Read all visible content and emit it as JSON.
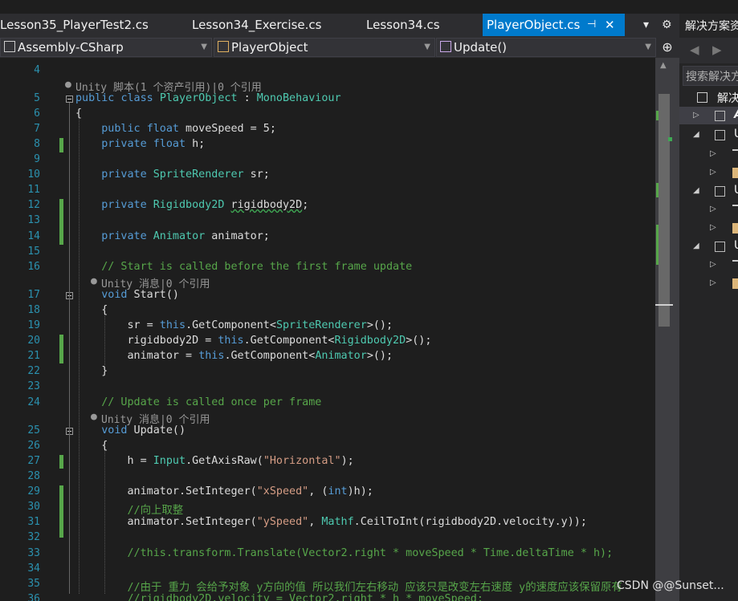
{
  "tabs": [
    {
      "label": "Lesson35_PlayerTest2.cs"
    },
    {
      "label": "Lesson34_Exercise.cs"
    },
    {
      "label": "Lesson34.cs"
    },
    {
      "label": "PlayerObject.cs",
      "active": true,
      "pin": "⊣",
      "close": "✕"
    }
  ],
  "toolbar": {
    "overflow_icon": "▾",
    "settings_icon": "⚙"
  },
  "nav": {
    "project": "Assembly-CSharp",
    "class": "PlayerObject",
    "member": "Update()",
    "split_icon": "⊕"
  },
  "solution_explorer": {
    "title": "解决方案资",
    "search_placeholder": "搜索解决方",
    "root_label": "解决",
    "nodes": [
      "A",
      "U",
      "U",
      "U"
    ]
  },
  "editor": {
    "lens_unity_script": "Unity 脚本(1 个资产引用)|0 个引用",
    "lens_unity_message": "Unity 消息|0 个引用",
    "lines": [
      {
        "n": "4",
        "t": ""
      },
      {
        "n": "5",
        "t": "public class PlayerObject : MonoBehaviour"
      },
      {
        "n": "6",
        "t": "{"
      },
      {
        "n": "7",
        "t": "    public float moveSpeed = 5;"
      },
      {
        "n": "8",
        "t": "    private float h;"
      },
      {
        "n": "9",
        "t": ""
      },
      {
        "n": "10",
        "t": "    private SpriteRenderer sr;"
      },
      {
        "n": "11",
        "t": ""
      },
      {
        "n": "12",
        "t": "    private Rigidbody2D rigidbody2D;"
      },
      {
        "n": "13",
        "t": ""
      },
      {
        "n": "14",
        "t": "    private Animator animator;"
      },
      {
        "n": "15",
        "t": ""
      },
      {
        "n": "16",
        "t": "    // Start is called before the first frame update"
      },
      {
        "n": "17",
        "t": "    void Start()"
      },
      {
        "n": "18",
        "t": "    {"
      },
      {
        "n": "19",
        "t": "        sr = this.GetComponent<SpriteRenderer>();"
      },
      {
        "n": "20",
        "t": "        rigidbody2D = this.GetComponent<Rigidbody2D>();"
      },
      {
        "n": "21",
        "t": "        animator = this.GetComponent<Animator>();"
      },
      {
        "n": "22",
        "t": "    }"
      },
      {
        "n": "23",
        "t": ""
      },
      {
        "n": "24",
        "t": "    // Update is called once per frame"
      },
      {
        "n": "25",
        "t": "    void Update()"
      },
      {
        "n": "26",
        "t": "    {"
      },
      {
        "n": "27",
        "t": "        h = Input.GetAxisRaw(\"Horizontal\");"
      },
      {
        "n": "28",
        "t": ""
      },
      {
        "n": "29",
        "t": "        animator.SetInteger(\"xSpeed\", (int)h);"
      },
      {
        "n": "30",
        "t": "        //向上取整"
      },
      {
        "n": "31",
        "t": "        animator.SetInteger(\"ySpeed\", Mathf.CeilToInt(rigidbody2D.velocity.y));"
      },
      {
        "n": "32",
        "t": ""
      },
      {
        "n": "33",
        "t": "        //this.transform.Translate(Vector2.right * moveSpeed * Time.deltaTime * h);"
      },
      {
        "n": "34",
        "t": ""
      },
      {
        "n": "35",
        "t": "        //由于 重力 会给予对象 y方向的值 所以我们左右移动 应该只是改变左右速度 y的速度应该保留原有"
      },
      {
        "n": "36",
        "t": "        //rigidbody2D.velocity = Vector2.right * h * moveSpeed;"
      }
    ]
  },
  "colors": {
    "background": "#1e1e1e",
    "keyword": "#569cd6",
    "type": "#4ec9b0",
    "comment": "#57a64a",
    "string": "#d69d85",
    "line_number": "#2b91af",
    "active_tab": "#007acc"
  },
  "watermark": "CSDN @@Sunset..."
}
